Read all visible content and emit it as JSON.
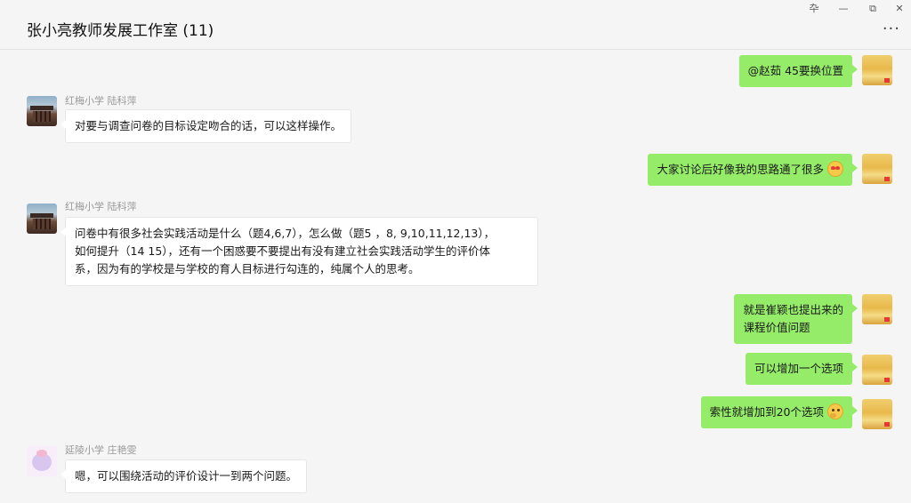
{
  "window": {
    "title": "张小亮教师发展工作室 (11)",
    "controls": {
      "pin": "卆",
      "minimize": "—",
      "restore": "⧉",
      "close": "✕"
    },
    "more": "···"
  },
  "messages": [
    {
      "side": "out",
      "text": "@赵茹 45要换位置"
    },
    {
      "side": "in",
      "sender": "红梅小学 陆科萍",
      "text": "对要与调查问卷的目标设定吻合的话，可以这样操作。"
    },
    {
      "side": "out",
      "text": "大家讨论后好像我的思路通了很多",
      "emoji": "heart-eyes-emoji"
    },
    {
      "side": "in",
      "sender": "红梅小学 陆科萍",
      "lines": [
        "问卷中有很多社会实践活动是什么（题4,6,7），怎么做（题5 ，8, 9,10,11,12,13），",
        "如何提升（14 15），还有一个困惑要不要提出有没有建立社会实践活动学生的评价体",
        "系，因为有的学校是与学校的育人目标进行勾连的，纯属个人的思考。"
      ]
    },
    {
      "side": "out",
      "lines": [
        "就是崔颖也提出来的",
        "课程价值问题"
      ]
    },
    {
      "side": "out",
      "text": "可以增加一个选项"
    },
    {
      "side": "out",
      "text": "索性就增加到20个选项",
      "emoji": "thinking-emoji"
    },
    {
      "side": "in",
      "sender": "延陵小学 庄艳雯",
      "text": "嗯，可以围绕活动的评价设计一到两个问题。"
    }
  ]
}
